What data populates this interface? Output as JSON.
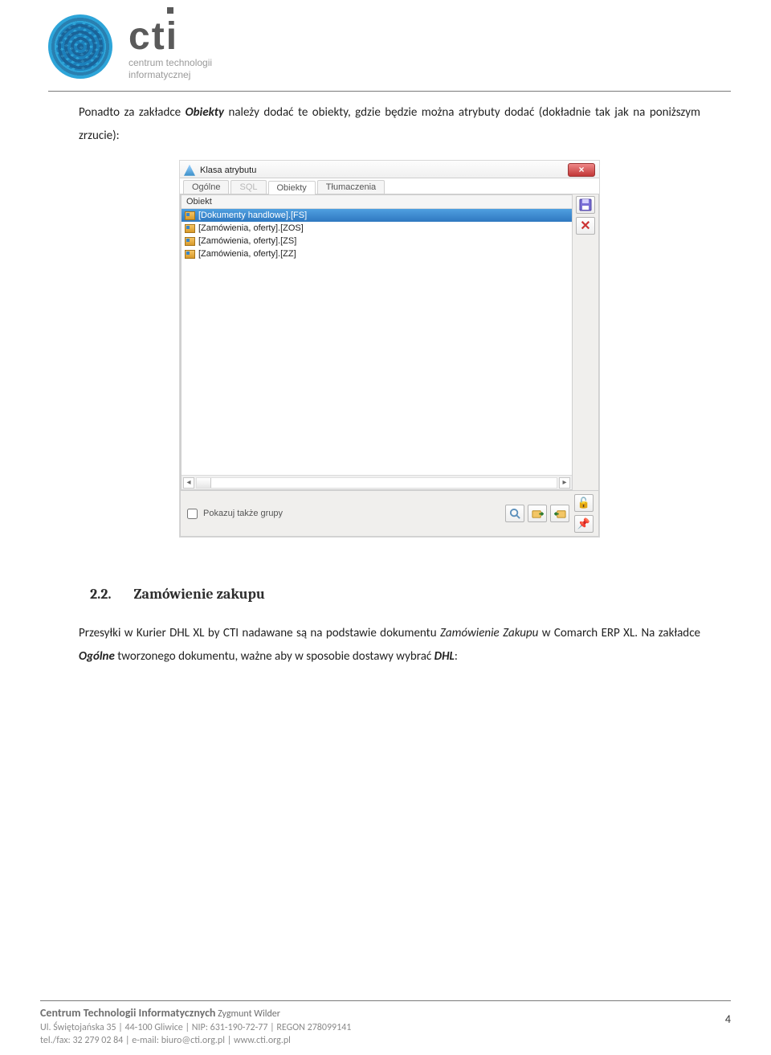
{
  "header": {
    "logo_line1": "centrum technologii",
    "logo_line2": "informatycznej"
  },
  "intro": {
    "pre": "Ponadto za zakładce ",
    "obiekty": "Obiekty",
    "post": " należy dodać te obiekty, gdzie będzie można atrybuty dodać (dokładnie tak jak na poniższym zrzucie):"
  },
  "dialog": {
    "title": "Klasa atrybutu",
    "tabs": [
      "Ogólne",
      "SQL",
      "Obiekty",
      "Tłumaczenia"
    ],
    "active_tab_index": 2,
    "disabled_tab_index": 1,
    "column_header": "Obiekt",
    "rows": [
      "[Dokumenty handlowe].[FS]",
      "[Zamówienia, oferty].[ZOS]",
      "[Zamówienia, oferty].[ZS]",
      "[Zamówienia, oferty].[ZZ]"
    ],
    "selected_row_index": 0,
    "show_groups_label": "Pokazuj także grupy",
    "close_symbol": "×"
  },
  "section": {
    "number": "2.2.",
    "title": "Zamówienie zakupu"
  },
  "para2": {
    "p1": "Przesyłki w Kurier DHL XL by CTI nadawane są na podstawie dokumentu ",
    "zz": "Zamówienie Zakupu",
    "p2": " w Comarch ERP XL. Na zakładce ",
    "og": "Ogólne",
    "p3": " tworzonego dokumentu, ważne aby w sposobie dostawy wybrać ",
    "dhl": "DHL",
    "p4": ":"
  },
  "footer": {
    "company": "Centrum Technologii Informatycznych",
    "owner": " Zygmunt Wilder",
    "line2": "Ul. Świętojańska 35  |  44-100 Gliwice  |  NIP: 631-190-72-77  |  REGON 278099141",
    "line3": "tel./fax: 32 279 02 84  |  e-mail: biuro@cti.org.pl  |  www.cti.org.pl",
    "page_number": "4"
  }
}
